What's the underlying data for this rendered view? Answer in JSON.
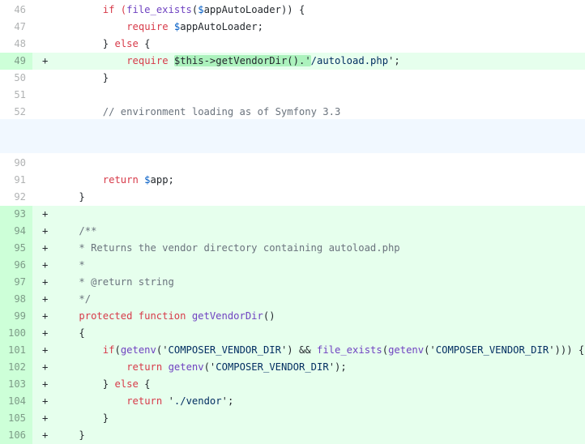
{
  "diff": {
    "lines": [
      {
        "num": "46",
        "type": "ctx",
        "indent": 8,
        "tokens": [
          {
            "t": "if (",
            "k": "key"
          },
          {
            "t": "file_exists",
            "k": "fn"
          },
          {
            "t": "(",
            "k": ""
          },
          {
            "t": "$",
            "k": "var"
          },
          {
            "t": "appAutoLoader)) {",
            "k": ""
          }
        ]
      },
      {
        "num": "47",
        "type": "ctx",
        "indent": 12,
        "tokens": [
          {
            "t": "require ",
            "k": "key"
          },
          {
            "t": "$",
            "k": "var"
          },
          {
            "t": "appAutoLoader;",
            "k": ""
          }
        ]
      },
      {
        "num": "48",
        "type": "ctx",
        "indent": 8,
        "tokens": [
          {
            "t": "} ",
            "k": ""
          },
          {
            "t": "else",
            "k": "key"
          },
          {
            "t": " {",
            "k": ""
          }
        ]
      },
      {
        "num": "49",
        "type": "add",
        "indent": 12,
        "tokens": [
          {
            "t": "require ",
            "k": "key"
          },
          {
            "t": "$this->getVendorDir().'",
            "k": "hl"
          },
          {
            "t": "/autoload.php",
            "k": "str"
          },
          {
            "t": "';",
            "k": ""
          }
        ]
      },
      {
        "num": "50",
        "type": "ctx",
        "indent": 8,
        "tokens": [
          {
            "t": "}",
            "k": ""
          }
        ]
      },
      {
        "num": "51",
        "type": "ctx",
        "indent": 0,
        "tokens": []
      },
      {
        "num": "52",
        "type": "ctx",
        "indent": 8,
        "tokens": [
          {
            "t": "// environment loading as of Symfony 3.3",
            "k": "cmt"
          }
        ]
      },
      {
        "num": "90",
        "type": "ctx",
        "indent": 0,
        "tokens": []
      },
      {
        "num": "91",
        "type": "ctx",
        "indent": 8,
        "tokens": [
          {
            "t": "return ",
            "k": "key"
          },
          {
            "t": "$",
            "k": "var"
          },
          {
            "t": "app;",
            "k": ""
          }
        ]
      },
      {
        "num": "92",
        "type": "ctx",
        "indent": 4,
        "tokens": [
          {
            "t": "}",
            "k": ""
          }
        ]
      },
      {
        "num": "93",
        "type": "add",
        "indent": 0,
        "tokens": []
      },
      {
        "num": "94",
        "type": "add",
        "indent": 4,
        "tokens": [
          {
            "t": "/**",
            "k": "cmt"
          }
        ]
      },
      {
        "num": "95",
        "type": "add",
        "indent": 4,
        "tokens": [
          {
            "t": "* Returns the vendor directory containing autoload.php",
            "k": "cmt"
          }
        ]
      },
      {
        "num": "96",
        "type": "add",
        "indent": 4,
        "tokens": [
          {
            "t": "*",
            "k": "cmt"
          }
        ]
      },
      {
        "num": "97",
        "type": "add",
        "indent": 4,
        "tokens": [
          {
            "t": "* @return string",
            "k": "cmt"
          }
        ]
      },
      {
        "num": "98",
        "type": "add",
        "indent": 4,
        "tokens": [
          {
            "t": "*/",
            "k": "cmt"
          }
        ]
      },
      {
        "num": "99",
        "type": "add",
        "indent": 4,
        "tokens": [
          {
            "t": "protected function ",
            "k": "key"
          },
          {
            "t": "getVendorDir",
            "k": "fn"
          },
          {
            "t": "()",
            "k": ""
          }
        ]
      },
      {
        "num": "100",
        "type": "add",
        "indent": 4,
        "tokens": [
          {
            "t": "{",
            "k": ""
          }
        ]
      },
      {
        "num": "101",
        "type": "add",
        "indent": 8,
        "tokens": [
          {
            "t": "if",
            "k": "key"
          },
          {
            "t": "(",
            "k": ""
          },
          {
            "t": "getenv",
            "k": "fn"
          },
          {
            "t": "('",
            "k": ""
          },
          {
            "t": "COMPOSER_VENDOR_DIR",
            "k": "str"
          },
          {
            "t": "') && ",
            "k": ""
          },
          {
            "t": "file_exists",
            "k": "fn"
          },
          {
            "t": "(",
            "k": ""
          },
          {
            "t": "getenv",
            "k": "fn"
          },
          {
            "t": "('",
            "k": ""
          },
          {
            "t": "COMPOSER_VENDOR_DIR",
            "k": "str"
          },
          {
            "t": "'))) {",
            "k": ""
          }
        ]
      },
      {
        "num": "102",
        "type": "add",
        "indent": 12,
        "tokens": [
          {
            "t": "return ",
            "k": "key"
          },
          {
            "t": "getenv",
            "k": "fn"
          },
          {
            "t": "('",
            "k": ""
          },
          {
            "t": "COMPOSER_VENDOR_DIR",
            "k": "str"
          },
          {
            "t": "');",
            "k": ""
          }
        ]
      },
      {
        "num": "103",
        "type": "add",
        "indent": 8,
        "tokens": [
          {
            "t": "} ",
            "k": ""
          },
          {
            "t": "else",
            "k": "key"
          },
          {
            "t": " {",
            "k": ""
          }
        ]
      },
      {
        "num": "104",
        "type": "add",
        "indent": 12,
        "tokens": [
          {
            "t": "return ",
            "k": "key"
          },
          {
            "t": "'",
            "k": ""
          },
          {
            "t": "./vendor",
            "k": "str"
          },
          {
            "t": "';",
            "k": ""
          }
        ]
      },
      {
        "num": "105",
        "type": "add",
        "indent": 8,
        "tokens": [
          {
            "t": "}",
            "k": ""
          }
        ]
      },
      {
        "num": "106",
        "type": "add",
        "indent": 4,
        "tokens": [
          {
            "t": "}",
            "k": ""
          }
        ]
      }
    ]
  },
  "markers": {
    "add": "+",
    "ctx": ""
  },
  "colors": {
    "added_line_bg": "#e6ffed",
    "added_num_bg": "#cdffd8",
    "hunk_bg": "#f1f8ff",
    "keyword": "#d73a49",
    "function": "#6f42c1",
    "variable": "#005cc5",
    "string": "#032f62",
    "comment": "#6a737d",
    "word_highlight": "#acf2bd"
  }
}
